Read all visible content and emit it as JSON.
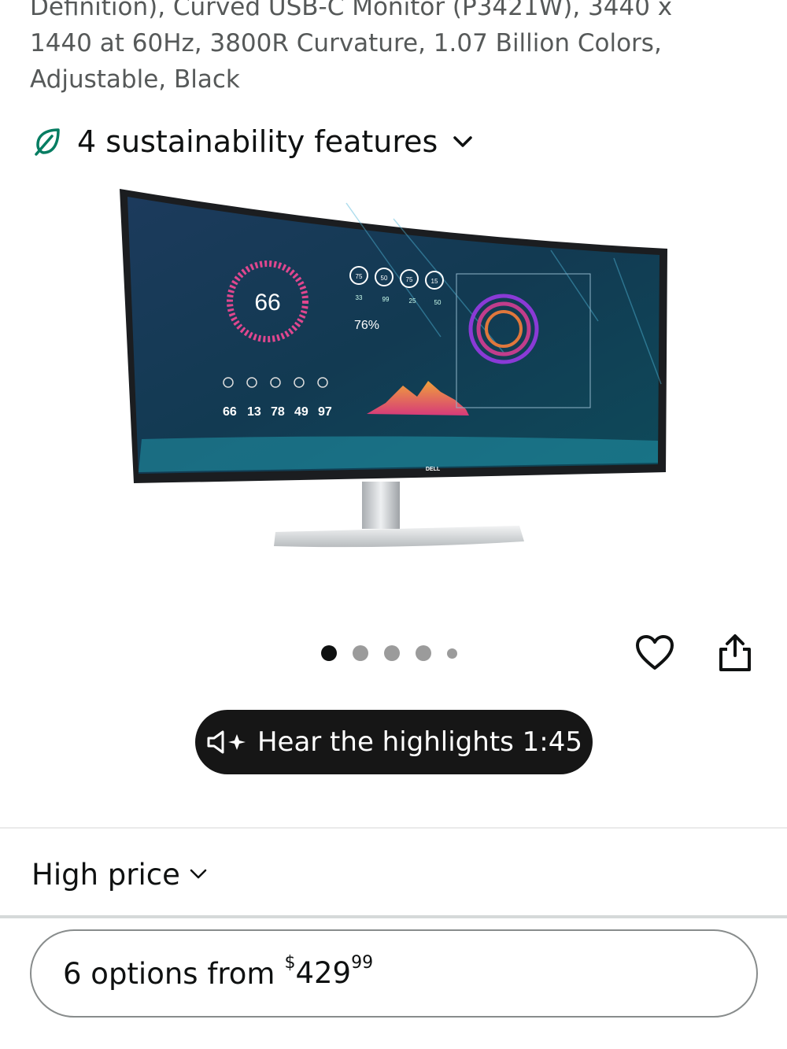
{
  "product": {
    "title_fragment": "Definition), Curved USB-C Monitor (P3421W), 3440 x 1440 at 60Hz, 3800R Curvature, 1.07 Billion Colors, Adjustable, Black"
  },
  "sustainability": {
    "label": "4 sustainability features",
    "icon": "leaf-icon",
    "accent_color": "#067d62"
  },
  "image": {
    "description_icon": "monitor-product-image",
    "screen": {
      "gauge_value": "66",
      "percent": "76%",
      "ring_labels": [
        "75",
        "50",
        "75",
        "15"
      ],
      "ring_values": [
        "33",
        "99",
        "25",
        "50"
      ],
      "stats": [
        "66",
        "13",
        "78",
        "49",
        "97"
      ],
      "brand": "DELL"
    }
  },
  "carousel": {
    "count": 5,
    "active_index": 0
  },
  "actions": {
    "wishlist_icon": "heart-icon",
    "share_icon": "share-icon"
  },
  "audio": {
    "label": "Hear the highlights 1:45",
    "icon": "speaker-sparkle-icon"
  },
  "price_filter": {
    "label": "High price"
  },
  "buying_options": {
    "label": "6 options from",
    "price_symbol": "$",
    "price_whole": "429",
    "price_fraction": "99"
  }
}
